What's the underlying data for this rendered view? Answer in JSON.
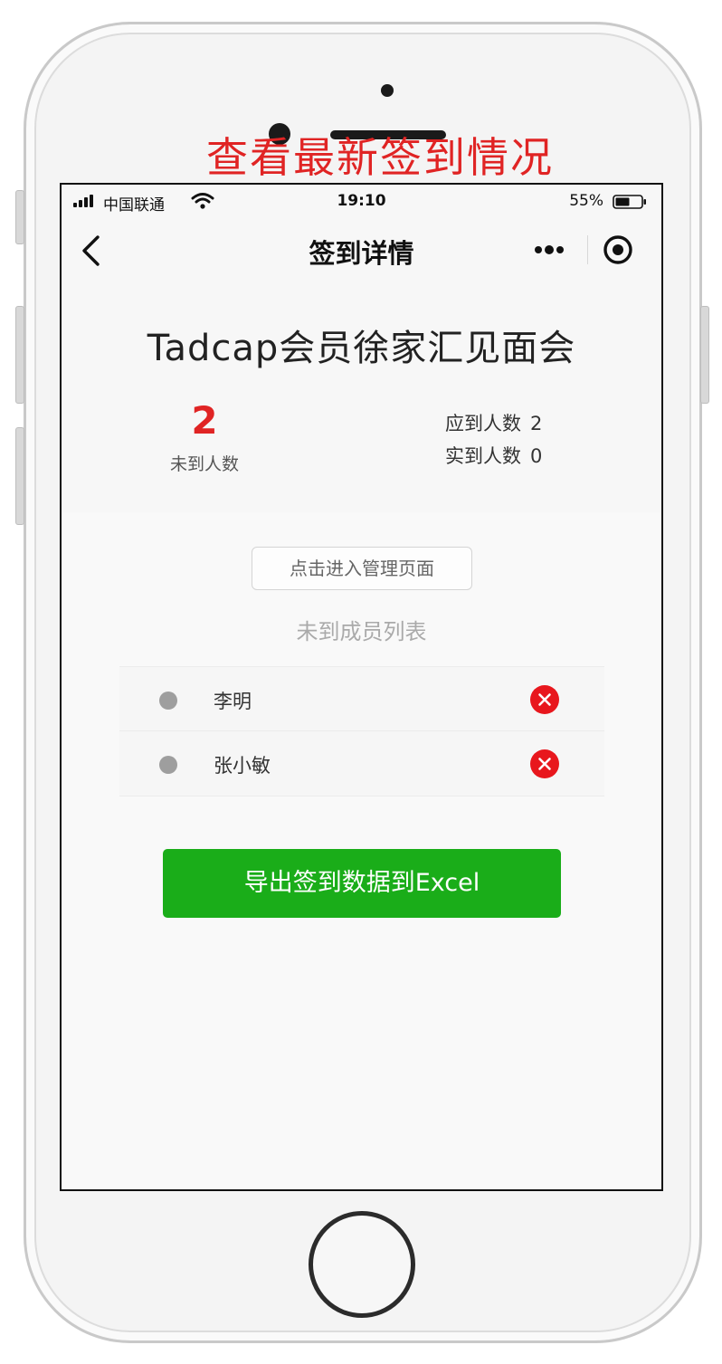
{
  "caption": "查看最新签到情况",
  "status_bar": {
    "carrier": "中国联通",
    "time": "19:10",
    "battery": "55%"
  },
  "nav": {
    "title": "签到详情"
  },
  "event": {
    "title": "Tadcap会员徐家汇见面会",
    "absent_count": "2",
    "absent_label": "未到人数",
    "expected_label": "应到人数",
    "expected_value": "2",
    "actual_label": "实到人数",
    "actual_value": "0"
  },
  "manage_button": "点击进入管理页面",
  "list": {
    "title": "未到成员列表",
    "members": [
      {
        "name": "李明"
      },
      {
        "name": "张小敏"
      }
    ]
  },
  "export_button": "导出签到数据到Excel",
  "colors": {
    "accent_red": "#e02424",
    "export_green": "#1aad19"
  },
  "icons": [
    "back-icon",
    "more-icon",
    "target-icon",
    "close-circle-icon",
    "signal-icon",
    "wifi-icon",
    "battery-icon"
  ]
}
